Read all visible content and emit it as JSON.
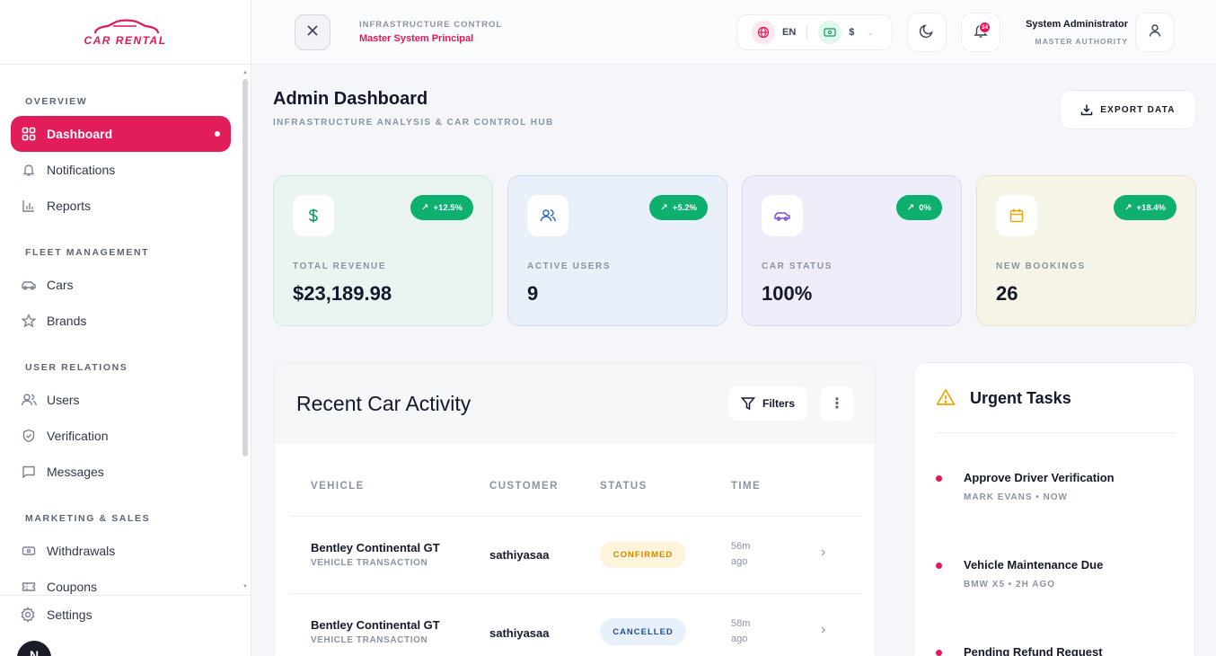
{
  "brand": {
    "name": "CAR RENTAL",
    "color": "#e0195a"
  },
  "sidebar": {
    "sections": [
      {
        "title": "OVERVIEW",
        "items": [
          {
            "label": "Dashboard",
            "icon": "grid-icon",
            "active": true
          },
          {
            "label": "Notifications",
            "icon": "bell-icon"
          },
          {
            "label": "Reports",
            "icon": "bar-chart-icon"
          }
        ]
      },
      {
        "title": "FLEET MANAGEMENT",
        "items": [
          {
            "label": "Cars",
            "icon": "car-icon"
          },
          {
            "label": "Brands",
            "icon": "star-icon"
          }
        ]
      },
      {
        "title": "USER RELATIONS",
        "items": [
          {
            "label": "Users",
            "icon": "users-icon"
          },
          {
            "label": "Verification",
            "icon": "shield-icon"
          },
          {
            "label": "Messages",
            "icon": "message-icon"
          }
        ]
      },
      {
        "title": "MARKETING & SALES",
        "items": [
          {
            "label": "Withdrawals",
            "icon": "wallet-icon"
          },
          {
            "label": "Coupons",
            "icon": "ticket-icon"
          }
        ]
      }
    ],
    "settings_label": "Settings",
    "user_initial": "N"
  },
  "header": {
    "subtitle": "INFRASTRUCTURE CONTROL",
    "title": "Master System Principal",
    "language": "EN",
    "currency": "$",
    "notification_count": "34",
    "admin_name": "System Administrator",
    "admin_role": "MASTER AUTHORITY"
  },
  "page": {
    "title": "Admin Dashboard",
    "subtitle": "INFRASTRUCTURE ANALYSIS & CAR CONTROL HUB",
    "export_label": "EXPORT DATA"
  },
  "stats": [
    {
      "label": "TOTAL REVENUE",
      "value": "$23,189.98",
      "trend": "+12.5%",
      "icon": "dollar-icon",
      "bg": "#eaf5f1",
      "border": "#cfe9df",
      "icon_color": "#0b9e60"
    },
    {
      "label": "ACTIVE USERS",
      "value": "9",
      "trend": "+5.2%",
      "icon": "users-icon",
      "bg": "#e9f0f9",
      "border": "#cddcf0",
      "icon_color": "#2b6cd1"
    },
    {
      "label": "CAR STATUS",
      "value": "100%",
      "trend": "0%",
      "icon": "car-icon",
      "bg": "#efedf9",
      "border": "#dcd7f1",
      "icon_color": "#7c4fe0"
    },
    {
      "label": "NEW BOOKINGS",
      "value": "26",
      "trend": "+18.4%",
      "icon": "calendar-icon",
      "bg": "#f6f3e7",
      "border": "#ebe3c8",
      "icon_color": "#e8a700"
    }
  ],
  "activity": {
    "title": "Recent Car Activity",
    "filters_label": "Filters",
    "columns": [
      "VEHICLE",
      "CUSTOMER",
      "STATUS",
      "TIME"
    ],
    "rows": [
      {
        "vehicle": "Bentley Continental GT",
        "sub": "VEHICLE TRANSACTION",
        "customer": "sathiyasaa",
        "status": "CONFIRMED",
        "time": "56m ago"
      },
      {
        "vehicle": "Bentley Continental GT",
        "sub": "VEHICLE TRANSACTION",
        "customer": "sathiyasaa",
        "status": "CANCELLED",
        "time": "58m ago"
      }
    ]
  },
  "urgent": {
    "title": "Urgent Tasks",
    "tasks": [
      {
        "title": "Approve Driver Verification",
        "sub": "MARK EVANS • NOW"
      },
      {
        "title": "Vehicle Maintenance Due",
        "sub": "BMW X5 • 2H AGO"
      },
      {
        "title": "Pending Refund Request",
        "sub": ""
      }
    ]
  }
}
